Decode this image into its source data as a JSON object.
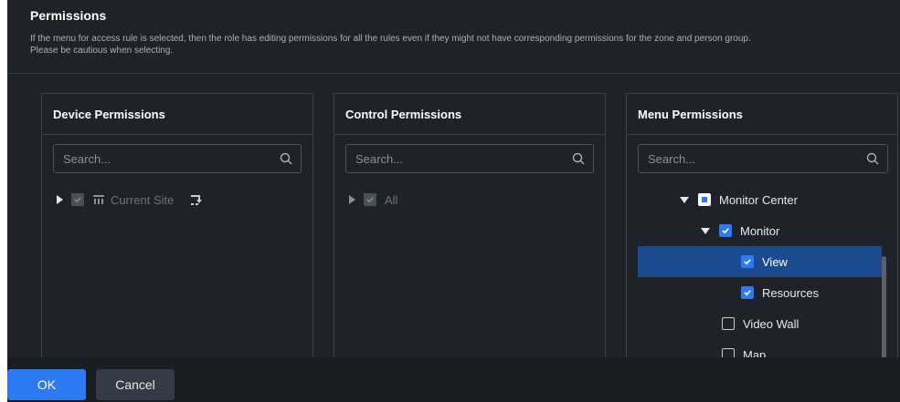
{
  "header": {
    "title": "Permissions",
    "description": "If the menu for access rule is selected, then the role has editing permissions for all the rules even if they might not have corresponding permissions for the zone and person group. Please be cautious when selecting."
  },
  "panels": {
    "device": {
      "title": "Device Permissions",
      "search_placeholder": "Search...",
      "tree": [
        {
          "label": "Current Site",
          "checked": true,
          "disabled": true
        }
      ]
    },
    "control": {
      "title": "Control Permissions",
      "search_placeholder": "Search...",
      "tree": [
        {
          "label": "All",
          "checked": true,
          "disabled": true
        }
      ]
    },
    "menu": {
      "title": "Menu Permissions",
      "search_placeholder": "Search...",
      "tree": [
        {
          "label": "Monitor Center",
          "state": "partial"
        },
        {
          "label": "Monitor",
          "state": "checked"
        },
        {
          "label": "View",
          "state": "checked",
          "selected": true
        },
        {
          "label": "Resources",
          "state": "checked"
        },
        {
          "label": "Video Wall",
          "state": "unchecked"
        },
        {
          "label": "Map",
          "state": "unchecked"
        }
      ]
    }
  },
  "footer": {
    "ok_label": "OK",
    "cancel_label": "Cancel"
  },
  "colors": {
    "primary": "#2d7bf4",
    "selected_row": "#1b4a8e",
    "background": "#1f2329"
  },
  "icons": [
    "search-icon",
    "site-icon",
    "site-action-icon",
    "caret-right-icon",
    "caret-down-icon"
  ]
}
